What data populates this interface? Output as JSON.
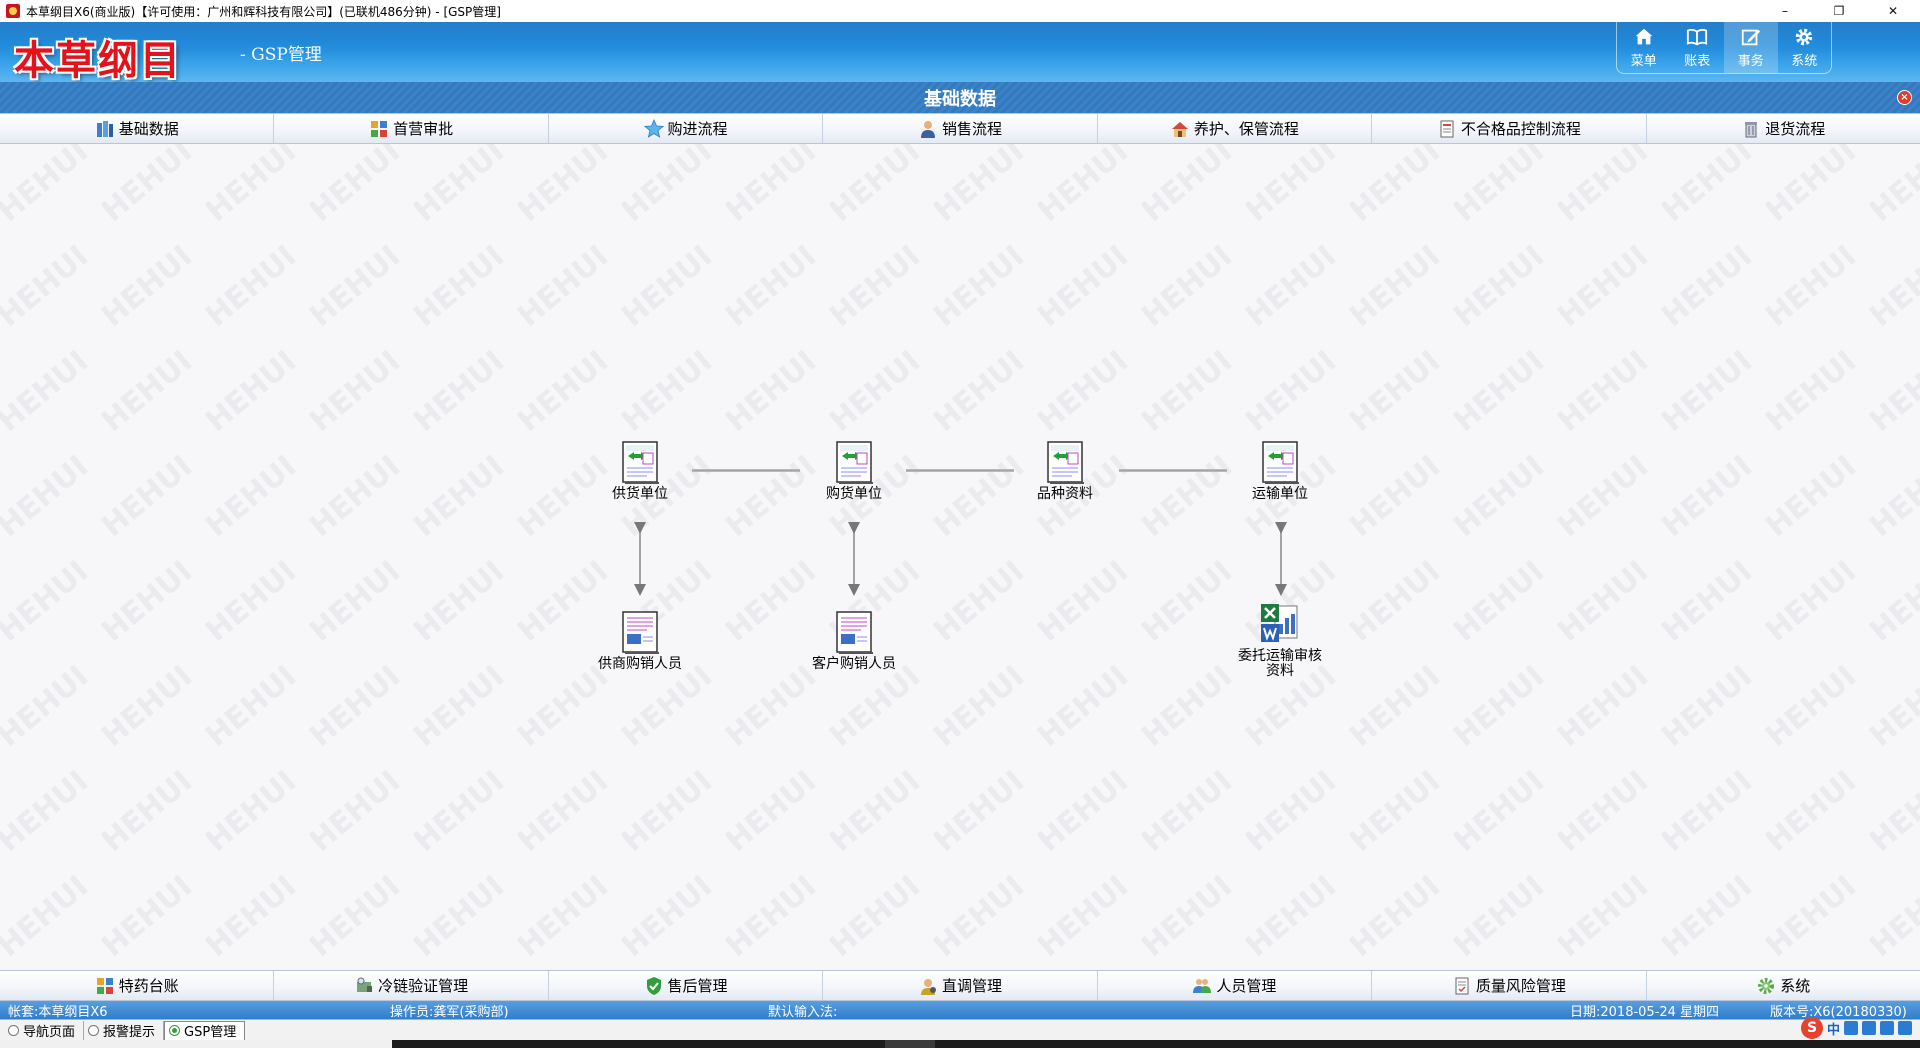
{
  "window": {
    "title": "本草纲目X6(商业版)【许可使用：广州和辉科技有限公司】(已联机486分钟) - [GSP管理]",
    "controls": [
      "–",
      "❐",
      "✕"
    ]
  },
  "header": {
    "logo": "本草纲目",
    "subtitle": "- GSP管理",
    "nav": [
      {
        "label": "菜单",
        "icon": "home-icon"
      },
      {
        "label": "账表",
        "icon": "book-icon"
      },
      {
        "label": "事务",
        "icon": "edit-icon",
        "active": true
      },
      {
        "label": "系统",
        "icon": "gear-icon"
      }
    ]
  },
  "section": {
    "title": "基础数据",
    "close": "×"
  },
  "top_tabs": [
    {
      "label": "基础数据",
      "icon": "books-icon"
    },
    {
      "label": "首营审批",
      "icon": "puzzle-icon"
    },
    {
      "label": "购进流程",
      "icon": "star-icon"
    },
    {
      "label": "销售流程",
      "icon": "person-icon"
    },
    {
      "label": "养护、保管流程",
      "icon": "house-icon"
    },
    {
      "label": "不合格品控制流程",
      "icon": "trash-doc-icon"
    },
    {
      "label": "退货流程",
      "icon": "bin-icon"
    }
  ],
  "diagram": {
    "nodes": [
      {
        "label": "供货单位",
        "icon": "data-card-icon"
      },
      {
        "label": "购货单位",
        "icon": "data-card-icon"
      },
      {
        "label": "品种资料",
        "icon": "data-card-icon"
      },
      {
        "label": "运输单位",
        "icon": "data-card-icon"
      },
      {
        "label": "供商购销人员",
        "icon": "person-card-icon"
      },
      {
        "label": "客户购销人员",
        "icon": "person-card-icon"
      },
      {
        "label": "委托运输审核资料",
        "icon": "office-docs-icon"
      }
    ]
  },
  "bottom_tabs": [
    {
      "label": "特药台账",
      "icon": "puzzle-icon"
    },
    {
      "label": "冷链验证管理",
      "icon": "cold-chain-icon"
    },
    {
      "label": "售后管理",
      "icon": "shield-icon"
    },
    {
      "label": "直调管理",
      "icon": "user-gear-icon"
    },
    {
      "label": "人员管理",
      "icon": "users-icon"
    },
    {
      "label": "质量风险管理",
      "icon": "doc-check-icon"
    },
    {
      "label": "系统",
      "icon": "gear-icon"
    }
  ],
  "status": {
    "account": "帐套:本草纲目X6",
    "operator": "操作员:龚军(采购部)",
    "input_method": "默认输入法:",
    "date": "日期:2018-05-24 星期四",
    "version": "版本号:X6(20180330)"
  },
  "task_tabs": [
    {
      "label": "导航页面",
      "active": false
    },
    {
      "label": "报警提示",
      "active": false
    },
    {
      "label": "GSP管理",
      "active": true
    }
  ],
  "ime": {
    "logo": "S",
    "mode": "中"
  },
  "watermark": "HEHUI"
}
